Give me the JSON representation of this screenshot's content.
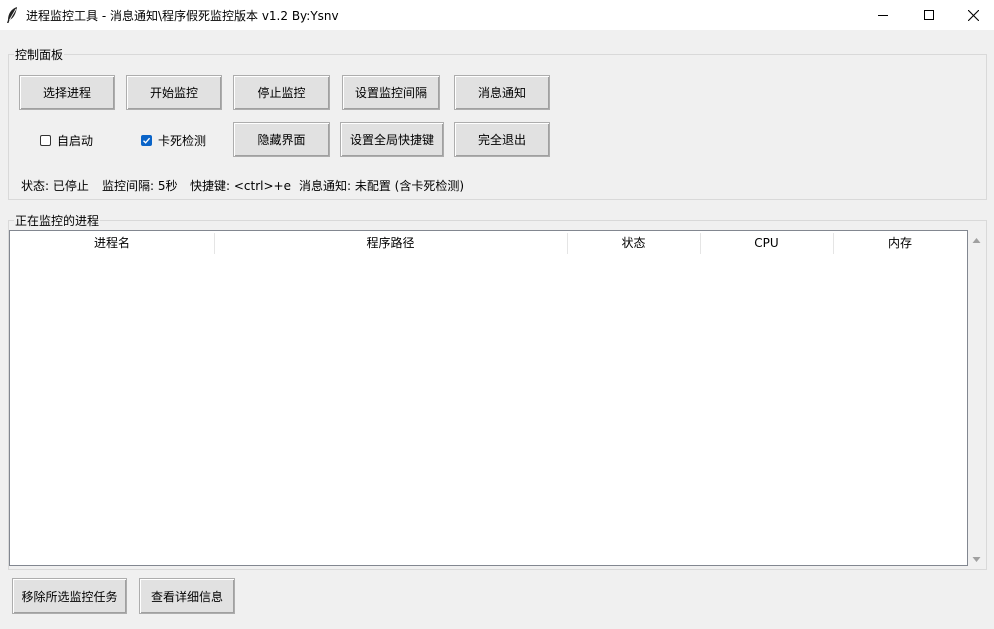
{
  "window": {
    "title": "进程监控工具 - 消息通知\\程序假死监控版本 v1.2    By:Ysnv"
  },
  "control_panel": {
    "label": "控制面板",
    "buttons_row1": {
      "select_process": "选择进程",
      "start_monitor": "开始监控",
      "stop_monitor": "停止监控",
      "set_interval": "设置监控间隔",
      "message_notify": "消息通知"
    },
    "buttons_row2": {
      "hide_ui": "隐藏界面",
      "set_hotkey": "设置全局快捷键",
      "quit": "完全退出"
    },
    "autostart": {
      "label": "自启动",
      "checked": false
    },
    "freeze_detect": {
      "label": "卡死检测",
      "checked": true
    },
    "status": {
      "state": "状态: 已停止",
      "interval": "监控间隔: 5秒",
      "hotkey": "快捷键: <ctrl>+e",
      "notify": "消息通知: 未配置 (含卡死检测)"
    }
  },
  "monitor_panel": {
    "label": "正在监控的进程",
    "columns": [
      "进程名",
      "程序路径",
      "状态",
      "CPU",
      "内存"
    ],
    "rows": []
  },
  "bottom": {
    "remove_selected": "移除所选监控任务",
    "view_details": "查看详细信息"
  },
  "colors": {
    "background": "#f0f0f0",
    "checkbox_accent": "#0a64c8"
  },
  "icons": [
    "feather-icon",
    "minimize-icon",
    "maximize-icon",
    "close-icon",
    "scroll-up-icon",
    "scroll-down-icon",
    "check-icon"
  ]
}
